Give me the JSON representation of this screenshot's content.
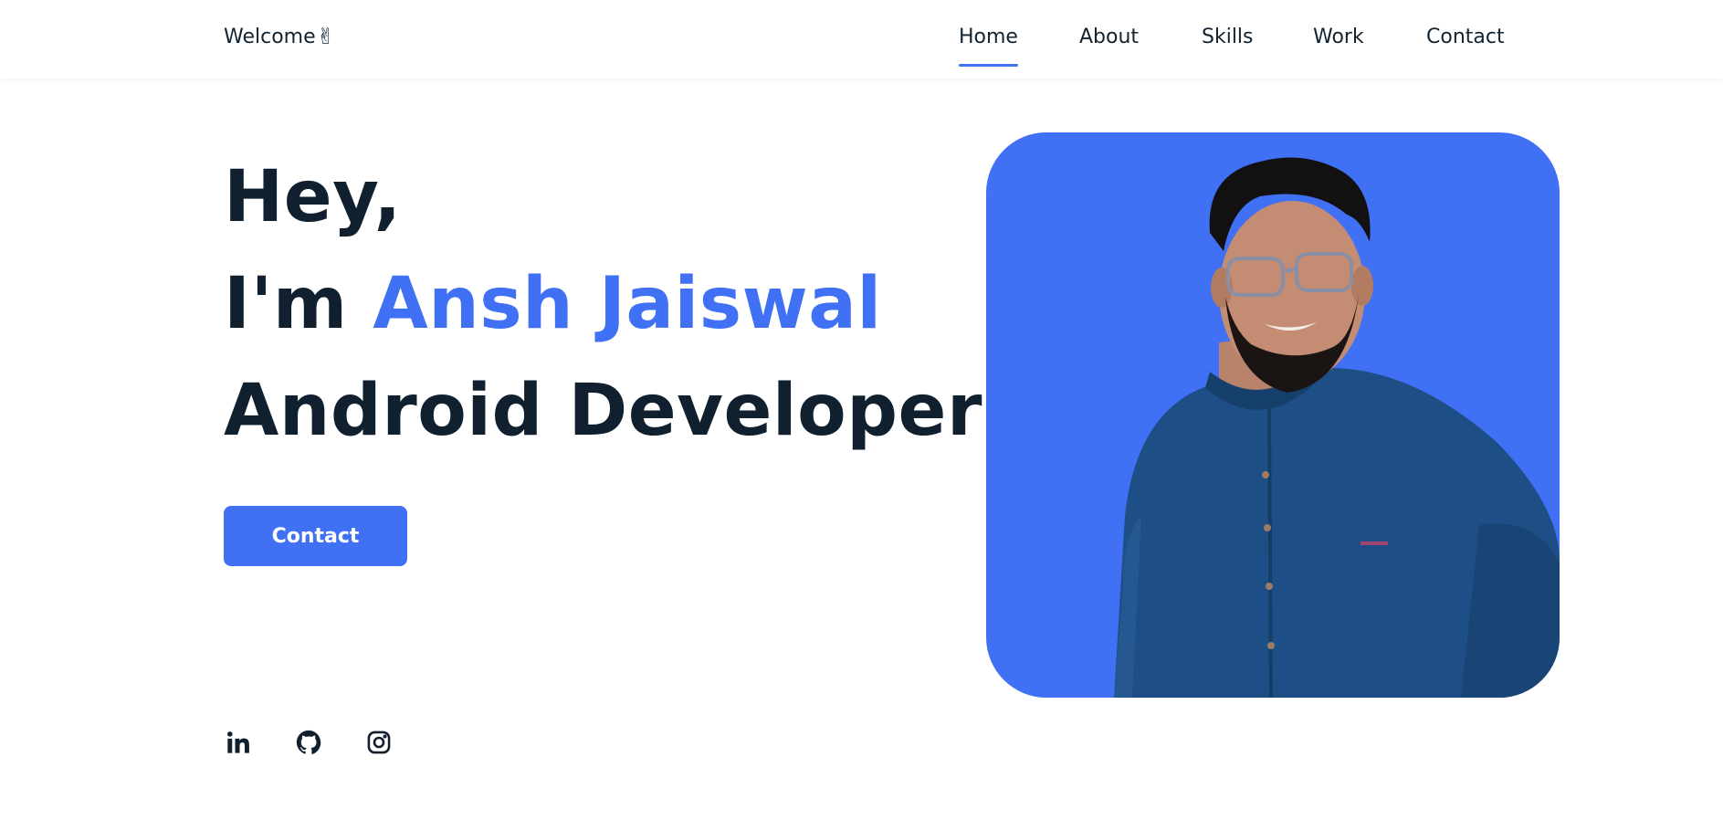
{
  "header": {
    "logo_text": "Welcome",
    "logo_emoji": "✌",
    "nav": [
      {
        "label": "Home",
        "active": true
      },
      {
        "label": "About",
        "active": false
      },
      {
        "label": "Skills",
        "active": false
      },
      {
        "label": "Work",
        "active": false
      },
      {
        "label": "Contact",
        "active": false
      }
    ]
  },
  "hero": {
    "greeting": "Hey,",
    "intro_prefix": "I'm ",
    "name": "Ansh Jaiswal",
    "role": "Android Developer",
    "cta_label": "Contact"
  },
  "socials": [
    {
      "name": "linkedin-icon",
      "label": "LinkedIn"
    },
    {
      "name": "github-icon",
      "label": "GitHub"
    },
    {
      "name": "instagram-icon",
      "label": "Instagram"
    }
  ],
  "colors": {
    "accent": "#4070f4",
    "text_dark": "#10202f",
    "background": "#ffffff"
  }
}
